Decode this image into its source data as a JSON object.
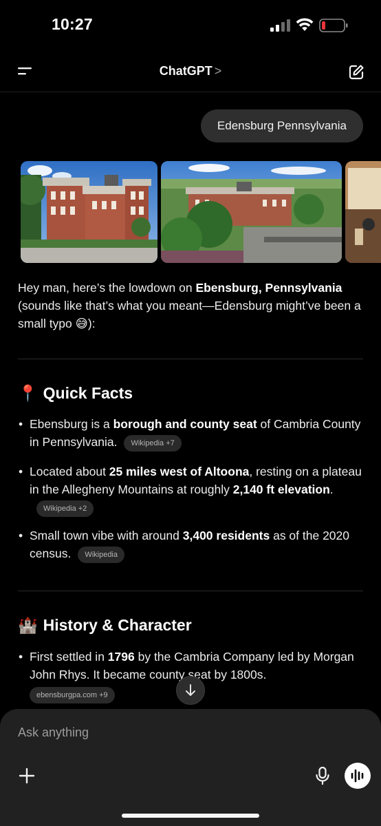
{
  "status_bar": {
    "time": "10:27"
  },
  "nav": {
    "title": "ChatGPT",
    "chevron": ">"
  },
  "user_message": "Edensburg Pennsylvania",
  "intro": {
    "prefix": "Hey man, here’s the lowdown on ",
    "bold": "Ebensburg, Pennsylvania",
    "suffix": " (sounds like that’s what you meant—Edensburg might’ve been a small typo ",
    "emoji": "😅",
    "end": "):"
  },
  "quick_facts": {
    "emoji": "📍",
    "title": "Quick Facts",
    "bullets": [
      {
        "pre": "Ebensburg is a ",
        "bold": "borough and county seat",
        "post": " of Cambria County in Pennsylvania.",
        "chip": "Wikipedia +7"
      },
      {
        "pre": "Located about ",
        "bold": "25 miles west of Altoona",
        "mid": ", resting on a plateau in the Allegheny Mountains at roughly ",
        "bold2": "2,140 ft elevation",
        "post": ".",
        "chip": "Wikipedia +2"
      },
      {
        "pre": "Small town vibe with around ",
        "bold": "3,400 residents",
        "post": " as of the 2020 census.",
        "chip": "Wikipedia"
      }
    ]
  },
  "history": {
    "emoji": "🏰",
    "title": "History & Character",
    "bullets": [
      {
        "pre": "First settled in ",
        "bold": "1796",
        "post": " by the Cambria Company led by Morgan John Rhys. It became county seat by 1800s.",
        "chip": "ebensburgpa.com +9"
      }
    ]
  },
  "composer": {
    "placeholder": "Ask anything"
  },
  "icons": {
    "menu": "menu-icon",
    "compose": "compose-icon",
    "plus": "plus-icon",
    "mic": "microphone-icon",
    "voice": "voice-waveform-icon",
    "scroll": "arrow-down-icon"
  },
  "colors": {
    "background": "#000000",
    "bubble": "#2f2f2f",
    "composer": "#212121",
    "chip": "#2a2a2a",
    "battery_low": "#e8343b"
  }
}
